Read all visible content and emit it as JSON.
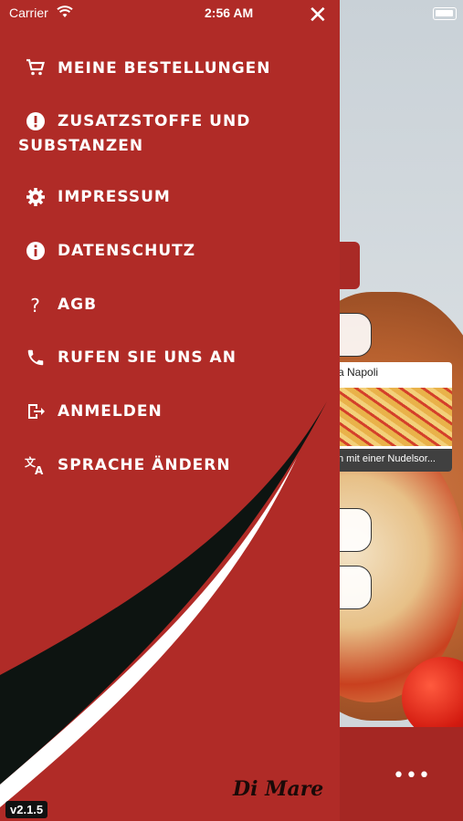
{
  "status_bar": {
    "carrier": "Carrier",
    "time": "2:56 AM"
  },
  "drawer": {
    "close_icon": "close-icon",
    "items": [
      {
        "label": "MEINE BESTELLUNGEN",
        "icon": "cart-icon"
      },
      {
        "label_line1": "ZUSATZSTOFFE UND",
        "label_line2": "SUBSTANZEN",
        "icon": "exclamation-icon"
      },
      {
        "label": "IMPRESSUM",
        "icon": "gear-icon"
      },
      {
        "label": "DATENSCHUTZ",
        "icon": "info-icon"
      },
      {
        "label": "AGB",
        "icon": "question-icon"
      },
      {
        "label": "RUFEN SIE UNS AN",
        "icon": "phone-icon"
      },
      {
        "label": "ANMELDEN",
        "icon": "login-icon"
      },
      {
        "label": "SPRACHE ÄNDERN",
        "icon": "translate-icon"
      }
    ],
    "logo_text": "Di Mare",
    "version": "v2.1.5"
  },
  "background": {
    "card_title": "a Napoli",
    "card_desc": "n mit einer Nudelsor..."
  },
  "colors": {
    "drawer": "#b02b27",
    "swoosh": "#0d1411",
    "bottom_bar": "#a52723"
  }
}
